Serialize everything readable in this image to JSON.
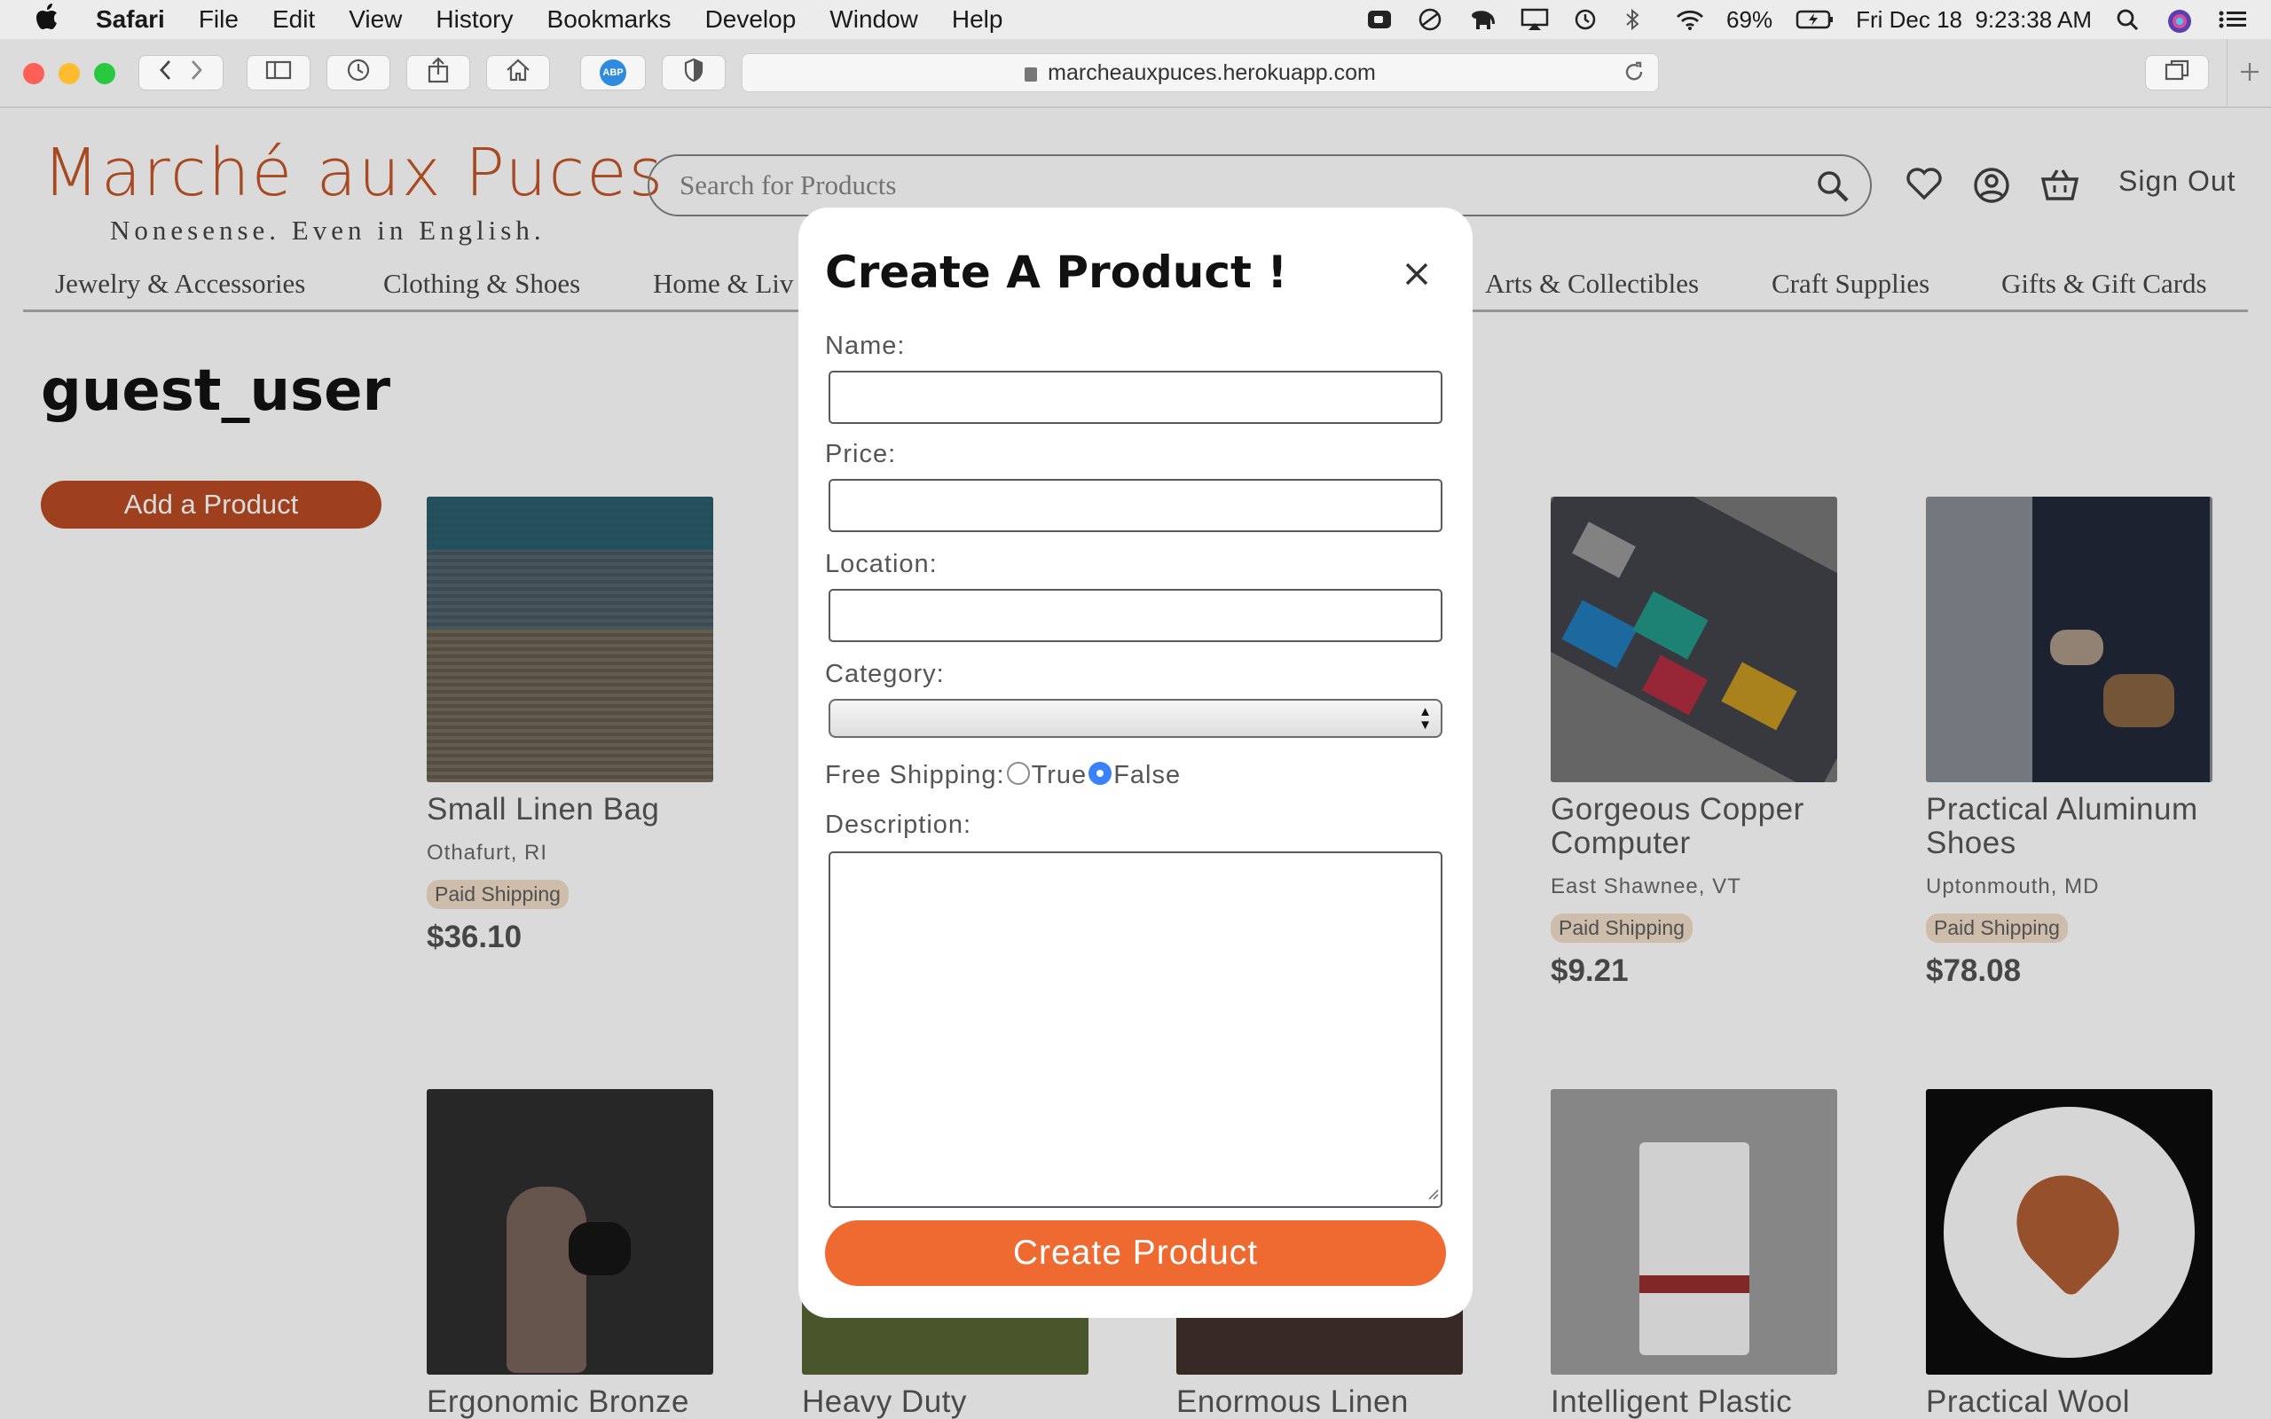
{
  "menubar": {
    "app": "Safari",
    "items": [
      "File",
      "Edit",
      "View",
      "History",
      "Bookmarks",
      "Develop",
      "Window",
      "Help"
    ],
    "battery": "69%",
    "datetime": "Fri Dec 18  9:23:38 AM"
  },
  "browser": {
    "url": "marcheauxpuces.herokuapp.com",
    "adblock_label": "ABP"
  },
  "site": {
    "logo": "Marché aux Puces",
    "tagline": "Nonesense. Even in English.",
    "search_placeholder": "Search for Products",
    "signout": "Sign Out",
    "categories": [
      "Jewelry & Accessories",
      "Clothing & Shoes",
      "Home & Liv",
      "Arts & Collectibles",
      "Craft Supplies",
      "Gifts & Gift Cards"
    ]
  },
  "profile": {
    "username": "guest_user",
    "add_product": "Add a Product"
  },
  "products": [
    {
      "name": "Small Linen Bag",
      "location": "Othafurt, RI",
      "shipping": "Paid Shipping",
      "price": "$36.10"
    },
    {
      "name": "Gorgeous Copper Computer",
      "location": "East Shawnee, VT",
      "shipping": "Paid Shipping",
      "price": "$9.21"
    },
    {
      "name": "Practical Aluminum Shoes",
      "location": "Uptonmouth, MD",
      "shipping": "Paid Shipping",
      "price": "$78.08"
    },
    {
      "name": "Ergonomic Bronze"
    },
    {
      "name": "Heavy Duty"
    },
    {
      "name": "Enormous Linen"
    },
    {
      "name": "Intelligent Plastic"
    },
    {
      "name": "Practical Wool"
    }
  ],
  "modal": {
    "title": "Create A Product !",
    "name_label": "Name:",
    "price_label": "Price:",
    "location_label": "Location:",
    "category_label": "Category:",
    "category_value": "",
    "free_shipping_label": "Free Shipping:",
    "option_true": "True",
    "option_false": "False",
    "selected_option": "False",
    "description_label": "Description:",
    "submit": "Create Product"
  },
  "colors": {
    "brand_orange": "#ef6a31",
    "radio_selected": "#3a82f7"
  }
}
